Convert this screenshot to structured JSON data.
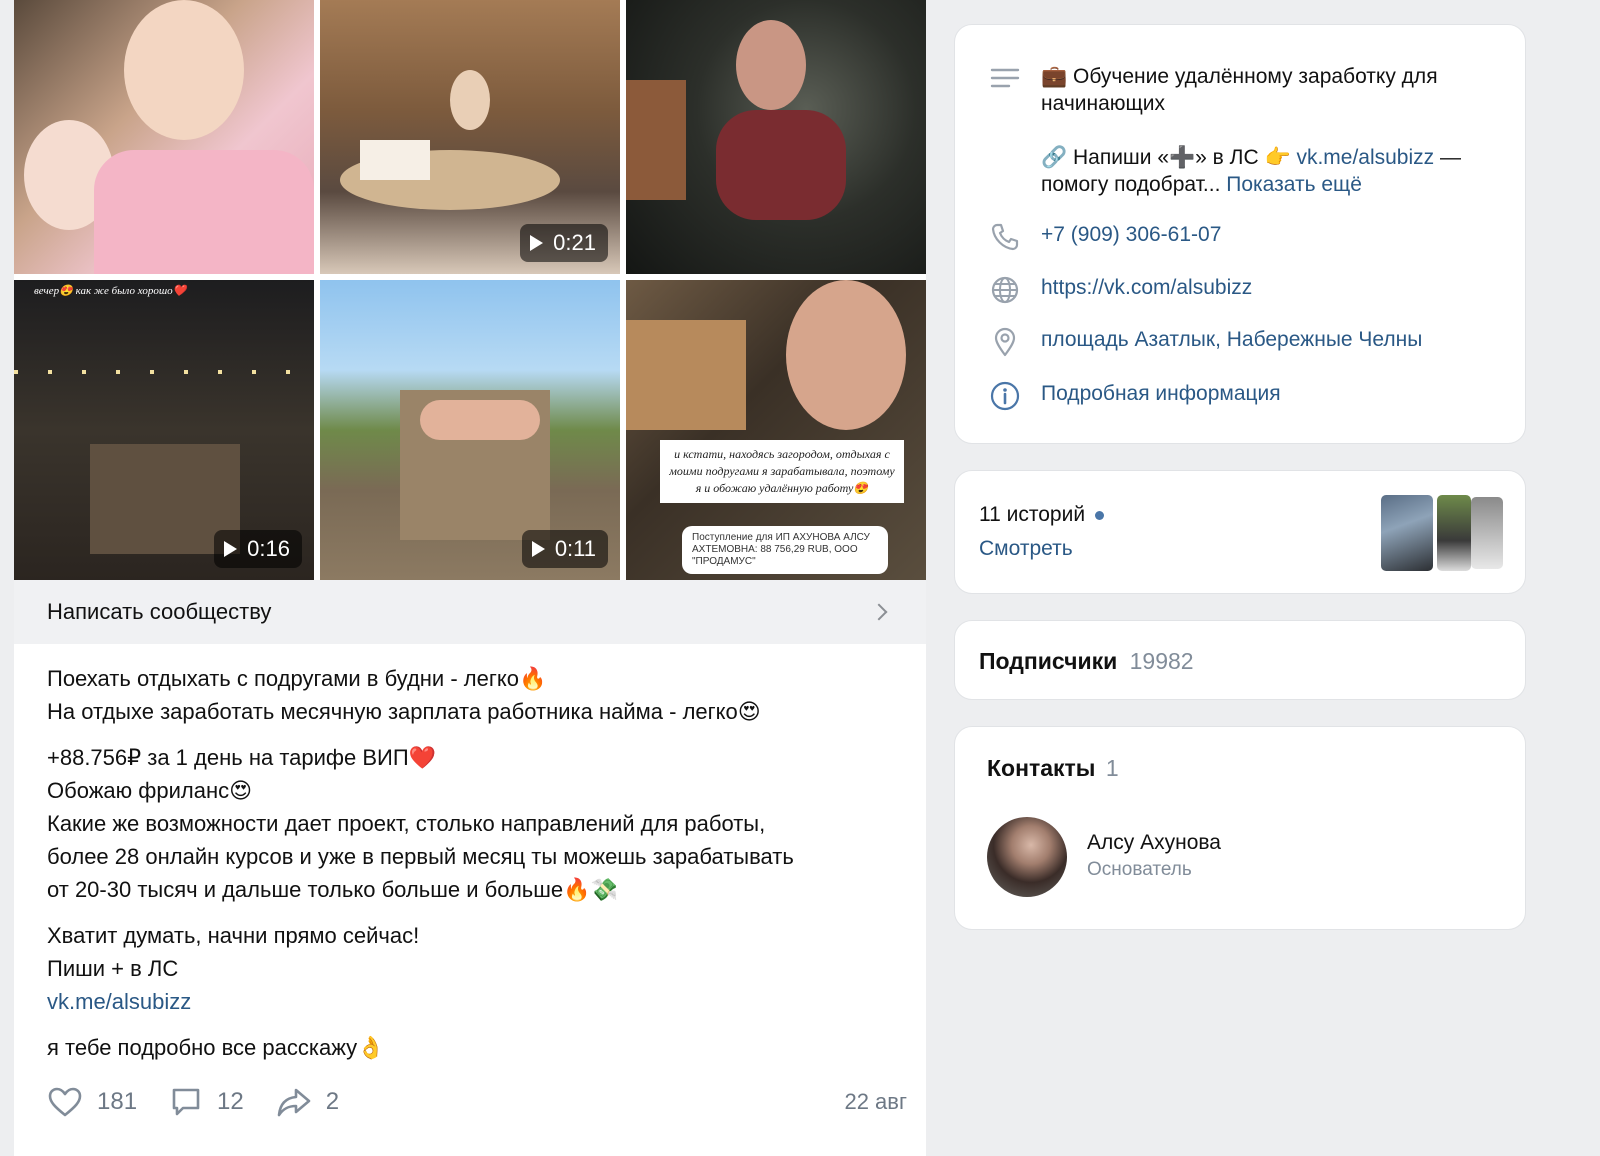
{
  "post": {
    "videos": [
      {
        "duration": "0:21"
      },
      {
        "duration": "0:16"
      },
      {
        "duration": "0:11"
      }
    ],
    "story_caption": "вечер😍 как же было хорошо❤️",
    "overlay_caption": "и кстати, находясь загородом, отдыхая с моими подругами я зарабатывала, поэтому я и обожаю удалённую работу😍",
    "overlay_receipt": "Поступление для ИП АХУНОВА АЛСУ АХТЕМОВНА: 88 756,29 RUB, ООО \"ПРОДАМУС\"",
    "message_bar_label": "Написать сообществу",
    "text": {
      "line1": "Поехать отдыхать с подругами в будни - легко🔥",
      "line2": "На отдыхе заработать месячную зарплата работника найма - легко😍",
      "line3": "+88.756₽ за 1 день на тарифе ВИП❤️",
      "line4": "Обожаю фриланс😍",
      "line5": "Какие же возможности дает проект, столько направлений для работы,",
      "line6": "более 28 онлайн курсов и уже в первый месяц ты можешь зарабатывать",
      "line7": "от 20-30 тысяч и дальше только больше и больше🔥💸",
      "line8": "Хватит думать, начни прямо сейчас!",
      "line9": "Пиши + в ЛС",
      "link": "vk.me/alsubizz",
      "line10": "я тебе подробно все расскажу👌"
    },
    "likes": "181",
    "comments": "12",
    "shares": "2",
    "date": "22 авг"
  },
  "info": {
    "description_line1": "💼 Обучение удалённому заработку для",
    "description_line2": "начинающих",
    "description_line3_prefix": "🔗 Напиши «➕» в ЛС 👉 ",
    "description_link": "vk.me/alsubizz",
    "description_line3_suffix": " —",
    "description_line4": "помогу подобрат...",
    "show_more": "Показать ещё",
    "phone": "+7 (909) 306-61-07",
    "website": "https://vk.com/alsubizz",
    "address": "площадь Азатлык, Набережные Челны",
    "details": "Подробная информация"
  },
  "stories": {
    "count_label": "11 историй",
    "watch_label": "Смотреть"
  },
  "subscribers": {
    "label": "Подписчики",
    "count": "19982"
  },
  "contacts": {
    "label": "Контакты",
    "count": "1",
    "person_name": "Алсу Ахунова",
    "person_role": "Основатель"
  },
  "colors": {
    "link": "#2a5885",
    "muted": "#818c99",
    "accent_dot": "#4a76a8"
  }
}
